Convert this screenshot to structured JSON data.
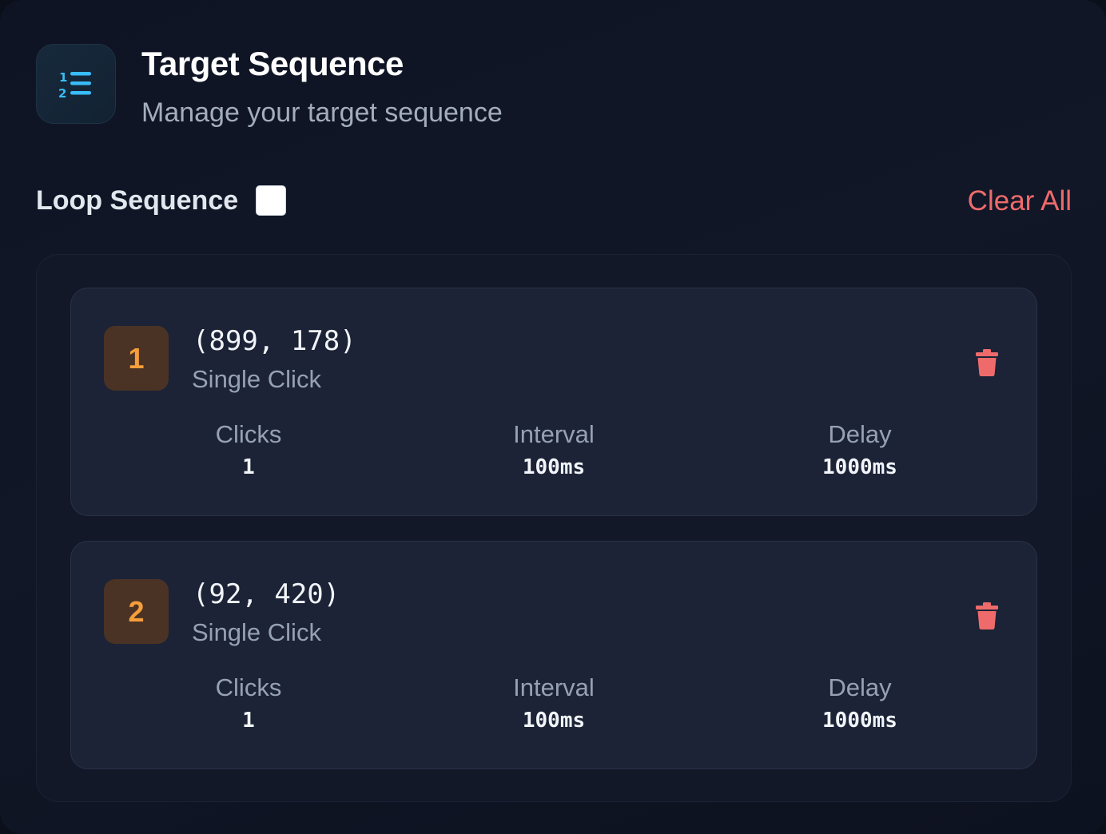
{
  "header": {
    "title": "Target Sequence",
    "subtitle": "Manage your target sequence",
    "icon": "numbered-list-icon"
  },
  "controls": {
    "loop_label": "Loop Sequence",
    "loop_checked": false,
    "clear_all_label": "Clear All"
  },
  "colors": {
    "accent_cyan": "#38bdf8",
    "badge_orange": "#f59e3b",
    "danger_red": "#ef6b6b"
  },
  "sequence": [
    {
      "index": "1",
      "coords": "(899, 178)",
      "type": "Single Click",
      "stats": {
        "clicks_label": "Clicks",
        "clicks": "1",
        "interval_label": "Interval",
        "interval": "100ms",
        "delay_label": "Delay",
        "delay": "1000ms"
      },
      "delete_icon": "trash-icon"
    },
    {
      "index": "2",
      "coords": "(92, 420)",
      "type": "Single Click",
      "stats": {
        "clicks_label": "Clicks",
        "clicks": "1",
        "interval_label": "Interval",
        "interval": "100ms",
        "delay_label": "Delay",
        "delay": "1000ms"
      },
      "delete_icon": "trash-icon"
    }
  ]
}
